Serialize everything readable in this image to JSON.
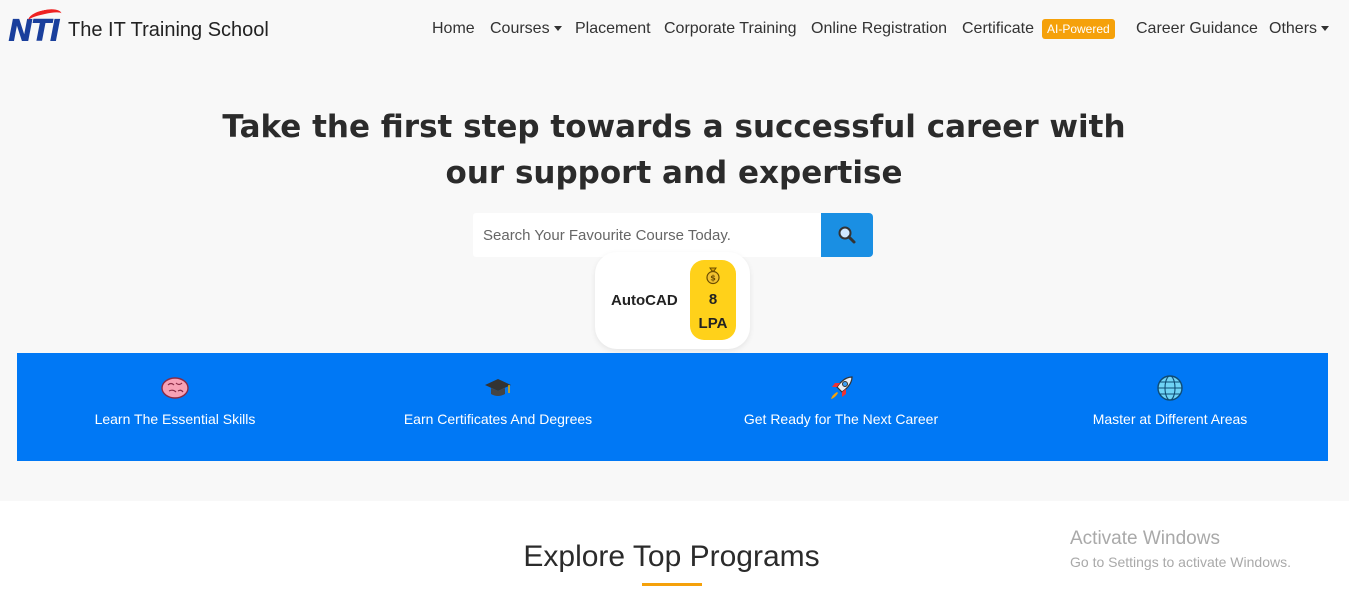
{
  "brand": {
    "logo_text": "NTI",
    "name": "The IT Training School"
  },
  "nav": {
    "home": "Home",
    "courses": "Courses",
    "placement": "Placement",
    "corporate": "Corporate Training",
    "online_registration": "Online Registration",
    "certificate": "Certificate",
    "ai_badge": "AI-Powered",
    "career_guidance": "Career Guidance",
    "others": "Others"
  },
  "hero": {
    "title_line1": "Take the first step towards a successful career with",
    "title_line2": "our support and expertise",
    "search_placeholder": "Search Your Favourite Course Today."
  },
  "salary_card": {
    "course": "AutoCAD",
    "amount": "8",
    "unit": "LPA"
  },
  "features": [
    {
      "label": "Learn The Essential Skills",
      "icon": "brain-icon"
    },
    {
      "label": "Earn Certificates And Degrees",
      "icon": "graduation-cap-icon"
    },
    {
      "label": "Get Ready for The Next Career",
      "icon": "rocket-icon"
    },
    {
      "label": "Master at Different Areas",
      "icon": "globe-icon"
    }
  ],
  "explore": {
    "title": "Explore Top Programs"
  },
  "watermark": {
    "title": "Activate Windows",
    "subtitle": "Go to Settings to activate Windows."
  },
  "colors": {
    "accent": "#0078f5",
    "badge": "#f5a10a",
    "salary_pill": "#ffd11a",
    "search_button": "#1a8fe3"
  }
}
